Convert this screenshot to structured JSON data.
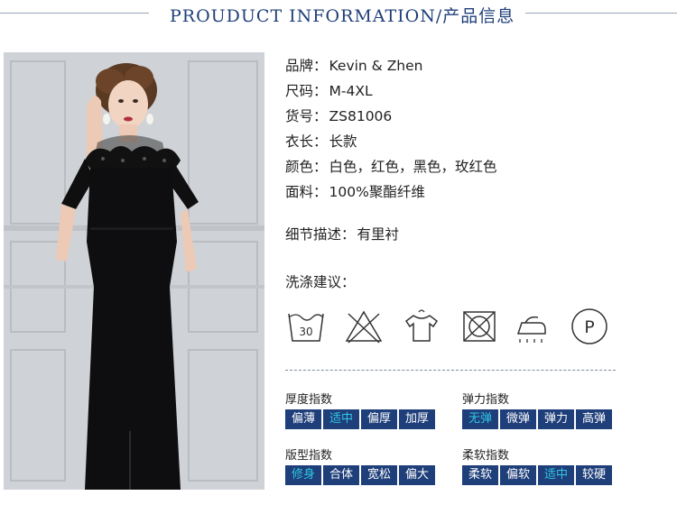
{
  "header": {
    "title": "PROUDUCT INFORMATION/产品信息"
  },
  "details": [
    {
      "key": "品牌：",
      "value": "Kevin & Zhen"
    },
    {
      "key": "尺码：",
      "value": "M-4XL"
    },
    {
      "key": "货号：",
      "value": "ZS81006"
    },
    {
      "key": "衣长：",
      "value": "长款"
    },
    {
      "key": "颜色：",
      "value": "白色，红色，黑色，玫红色"
    },
    {
      "key": "面料：",
      "value": "100%聚酯纤维"
    }
  ],
  "detail_desc": {
    "key": "细节描述：",
    "value": "有里衬"
  },
  "care": {
    "title": "洗涤建议：",
    "icons": [
      "wash-30-icon",
      "do-not-bleach-icon",
      "hang-dry-icon",
      "do-not-tumble-dry-icon",
      "iron-icon",
      "dry-clean-p-icon"
    ],
    "wash_temp": "30",
    "dryclean_letter": "P"
  },
  "indices": [
    {
      "title": "厚度指数",
      "options": [
        "偏薄",
        "适中",
        "偏厚",
        "加厚"
      ],
      "selected": 1
    },
    {
      "title": "弹力指数",
      "options": [
        "无弹",
        "微弹",
        "弹力",
        "高弹"
      ],
      "selected": 0
    },
    {
      "title": "版型指数",
      "options": [
        "修身",
        "合体",
        "宽松",
        "偏大"
      ],
      "selected": 0
    },
    {
      "title": "柔软指数",
      "options": [
        "柔软",
        "偏软",
        "适中",
        "较硬"
      ],
      "selected": 2
    }
  ],
  "colors": {
    "accent": "#1f3f7a",
    "chip_selected_text": "#30c6e4"
  }
}
